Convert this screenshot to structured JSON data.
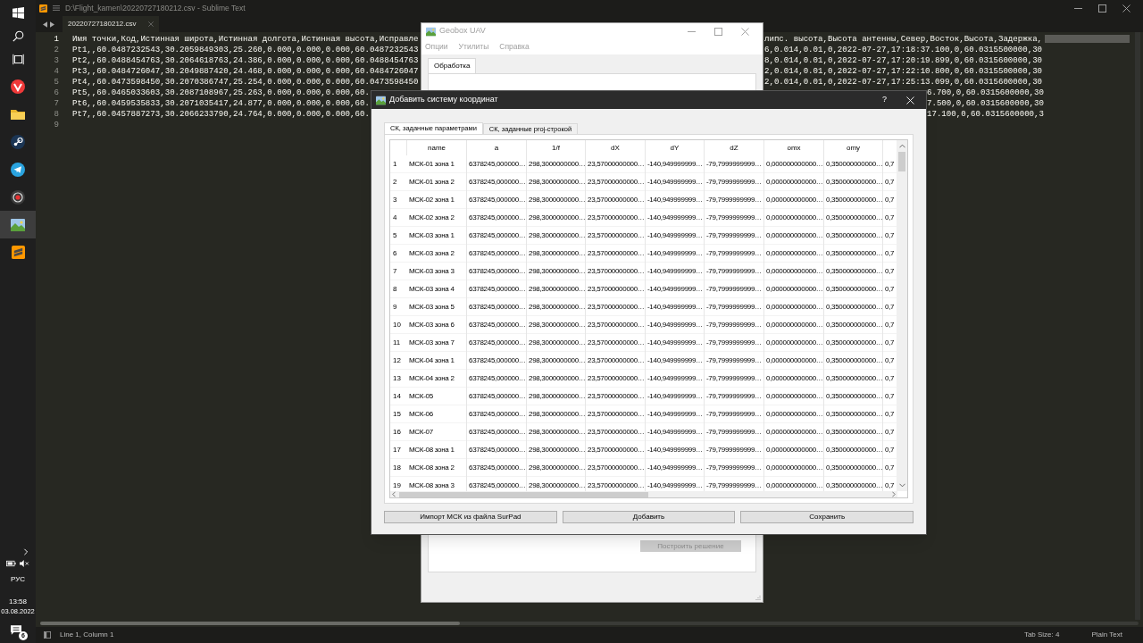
{
  "taskbar": {
    "apps": [
      {
        "kind": "windows",
        "selected": false
      },
      {
        "kind": "search",
        "selected": false
      },
      {
        "kind": "taskview",
        "selected": false
      },
      {
        "kind": "browser",
        "selected": false
      },
      {
        "kind": "folder",
        "selected": false
      },
      {
        "kind": "steam",
        "selected": false
      },
      {
        "kind": "messenger",
        "selected": false
      },
      {
        "kind": "recorder",
        "selected": false
      },
      {
        "kind": "geobox",
        "selected": true
      },
      {
        "kind": "sublime",
        "selected": false
      }
    ],
    "tray": {
      "language": "РУС",
      "time": "13:58",
      "date": "03.08.2022",
      "notifications": "6"
    }
  },
  "editor": {
    "title": "D:\\Flight_kamen\\20220727180212.csv - Sublime Text",
    "tabs": [
      {
        "label": "20220727180212.csv",
        "selected": true
      }
    ],
    "lines": [
      {
        "number": "1",
        "current": true,
        "text": "Имя точки,Код,Истинная широта,Истинная долгота,Истинная высота,Исправле",
        "tail": "липс. высота,Высота антенны,Север,Восток,Высота,Задержка,"
      },
      {
        "number": "2",
        "current": false,
        "text": "Pt1,,60.0487232543,30.2059849303,25.260,0.000,0.000,0.000,60.0487232543",
        "tail": "6,0.014,0.01,0,2022-07-27,17:18:37.100,0,60.0315500000,30"
      },
      {
        "number": "3",
        "current": false,
        "text": "Pt2,,60.0488454763,30.2064618763,24.386,0.000,0.000,0.000,60.0488454763",
        "tail": "8,0.014,0.01,0,2022-07-27,17:20:19.899,0,60.0315600000,30"
      },
      {
        "number": "4",
        "current": false,
        "text": "Pt3,,60.0484726047,30.2049887420,24.468,0.000,0.000,0.000,60.0484726047",
        "tail": "2,0.014,0.01,0,2022-07-27,17:22:10.800,0,60.0315500000,30"
      },
      {
        "number": "5",
        "current": false,
        "text": "Pt4,,60.0473598450,30.2070386747,25.254,0.000,0.000,0.000,60.0473598450",
        "tail": "2,0.014,0.01,0,2022-07-27,17:25:13.099,0,60.0315600000,30"
      },
      {
        "number": "6",
        "current": false,
        "text": "Pt5,,60.0465033603,30.2087108967,25.263,0.000,0.000,0.000,60.",
        "tail": "6.700,0,60.0315600000,30"
      },
      {
        "number": "7",
        "current": false,
        "text": "Pt6,,60.0459535833,30.2071035417,24.877,0.000,0.000,0.000,60.",
        "tail": "7.500,0,60.0315600000,30"
      },
      {
        "number": "8",
        "current": false,
        "text": "Pt7,,60.0457887273,30.2066233790,24.764,0.000,0.000,0.000,60.",
        "tail": "17.100,0,60.0315600000,3"
      },
      {
        "number": "9",
        "current": false
      }
    ],
    "status": {
      "position": "Line 1, Column 1",
      "tab_size": "Tab Size: 4",
      "syntax": "Plain Text"
    }
  },
  "geobox": {
    "title": "Geobox UAV",
    "menu": [
      "Опции",
      "Утилиты",
      "Справка"
    ],
    "tabs": [
      {
        "label": "Обработка",
        "selected": true
      }
    ],
    "buttons": [
      {
        "label": "Построить решение",
        "disabled": true
      }
    ]
  },
  "dialog": {
    "title": "Добавить систему координат",
    "help": "?",
    "tabs": [
      {
        "label": "СК, заданные параметрами",
        "selected": true
      },
      {
        "label": "СК, заданные proj-строкой",
        "selected": false
      }
    ],
    "table": {
      "columns": [
        "name",
        "a",
        "1/f",
        "dX",
        "dY",
        "dZ",
        "omx",
        "omy"
      ],
      "rows": [
        {
          "number": "1",
          "cells": [
            "МСК-01 зона 1",
            "6378245,000000…",
            "298,3000000000…",
            "23,57000000000…",
            "-140,949999999…",
            "-79,7999999999…",
            "0,000000000000…",
            "0,350000000000…",
            "0,7"
          ]
        },
        {
          "number": "2",
          "cells": [
            "МСК-01 зона 2",
            "6378245,000000…",
            "298,3000000000…",
            "23,57000000000…",
            "-140,949999999…",
            "-79,7999999999…",
            "0,000000000000…",
            "0,350000000000…",
            "0,7"
          ]
        },
        {
          "number": "3",
          "cells": [
            "МСК-02 зона 1",
            "6378245,000000…",
            "298,3000000000…",
            "23,57000000000…",
            "-140,949999999…",
            "-79,7999999999…",
            "0,000000000000…",
            "0,350000000000…",
            "0,7"
          ]
        },
        {
          "number": "4",
          "cells": [
            "МСК-02 зона 2",
            "6378245,000000…",
            "298,3000000000…",
            "23,57000000000…",
            "-140,949999999…",
            "-79,7999999999…",
            "0,000000000000…",
            "0,350000000000…",
            "0,7"
          ]
        },
        {
          "number": "5",
          "cells": [
            "МСК-03 зона 1",
            "6378245,000000…",
            "298,3000000000…",
            "23,57000000000…",
            "-140,949999999…",
            "-79,7999999999…",
            "0,000000000000…",
            "0,350000000000…",
            "0,7"
          ]
        },
        {
          "number": "6",
          "cells": [
            "МСК-03 зона 2",
            "6378245,000000…",
            "298,3000000000…",
            "23,57000000000…",
            "-140,949999999…",
            "-79,7999999999…",
            "0,000000000000…",
            "0,350000000000…",
            "0,7"
          ]
        },
        {
          "number": "7",
          "cells": [
            "МСК-03 зона 3",
            "6378245,000000…",
            "298,3000000000…",
            "23,57000000000…",
            "-140,949999999…",
            "-79,7999999999…",
            "0,000000000000…",
            "0,350000000000…",
            "0,7"
          ]
        },
        {
          "number": "8",
          "cells": [
            "МСК-03 зона 4",
            "6378245,000000…",
            "298,3000000000…",
            "23,57000000000…",
            "-140,949999999…",
            "-79,7999999999…",
            "0,000000000000…",
            "0,350000000000…",
            "0,7"
          ]
        },
        {
          "number": "9",
          "cells": [
            "МСК-03 зона 5",
            "6378245,000000…",
            "298,3000000000…",
            "23,57000000000…",
            "-140,949999999…",
            "-79,7999999999…",
            "0,000000000000…",
            "0,350000000000…",
            "0,7"
          ]
        },
        {
          "number": "10",
          "cells": [
            "МСК-03 зона 6",
            "6378245,000000…",
            "298,3000000000…",
            "23,57000000000…",
            "-140,949999999…",
            "-79,7999999999…",
            "0,000000000000…",
            "0,350000000000…",
            "0,7"
          ]
        },
        {
          "number": "11",
          "cells": [
            "МСК-03 зона 7",
            "6378245,000000…",
            "298,3000000000…",
            "23,57000000000…",
            "-140,949999999…",
            "-79,7999999999…",
            "0,000000000000…",
            "0,350000000000…",
            "0,7"
          ]
        },
        {
          "number": "12",
          "cells": [
            "МСК-04 зона 1",
            "6378245,000000…",
            "298,3000000000…",
            "23,57000000000…",
            "-140,949999999…",
            "-79,7999999999…",
            "0,000000000000…",
            "0,350000000000…",
            "0,7"
          ]
        },
        {
          "number": "13",
          "cells": [
            "МСК-04 зона 2",
            "6378245,000000…",
            "298,3000000000…",
            "23,57000000000…",
            "-140,949999999…",
            "-79,7999999999…",
            "0,000000000000…",
            "0,350000000000…",
            "0,7"
          ]
        },
        {
          "number": "14",
          "cells": [
            "МСК-05",
            "6378245,000000…",
            "298,3000000000…",
            "23,57000000000…",
            "-140,949999999…",
            "-79,7999999999…",
            "0,000000000000…",
            "0,350000000000…",
            "0,7"
          ]
        },
        {
          "number": "15",
          "cells": [
            "МСК-06",
            "6378245,000000…",
            "298,3000000000…",
            "23,57000000000…",
            "-140,949999999…",
            "-79,7999999999…",
            "0,000000000000…",
            "0,350000000000…",
            "0,7"
          ]
        },
        {
          "number": "16",
          "cells": [
            "МСК-07",
            "6378245,000000…",
            "298,3000000000…",
            "23,57000000000…",
            "-140,949999999…",
            "-79,7999999999…",
            "0,000000000000…",
            "0,350000000000…",
            "0,7"
          ]
        },
        {
          "number": "17",
          "cells": [
            "МСК-08 зона 1",
            "6378245,000000…",
            "298,3000000000…",
            "23,57000000000…",
            "-140,949999999…",
            "-79,7999999999…",
            "0,000000000000…",
            "0,350000000000…",
            "0,7"
          ]
        },
        {
          "number": "18",
          "cells": [
            "МСК-08 зона 2",
            "6378245,000000…",
            "298,3000000000…",
            "23,57000000000…",
            "-140,949999999…",
            "-79,7999999999…",
            "0,000000000000…",
            "0,350000000000…",
            "0,7"
          ]
        },
        {
          "number": "19",
          "cells": [
            "МСК-08 зона 3",
            "6378245,000000…",
            "298,3000000000…",
            "23,57000000000…",
            "-140,949999999…",
            "-79,7999999999…",
            "0,000000000000…",
            "0,350000000000…",
            "0,7"
          ]
        }
      ]
    },
    "buttons": [
      "Импорт МСК из файла SurPad",
      "Добавить",
      "Сохранить"
    ]
  }
}
